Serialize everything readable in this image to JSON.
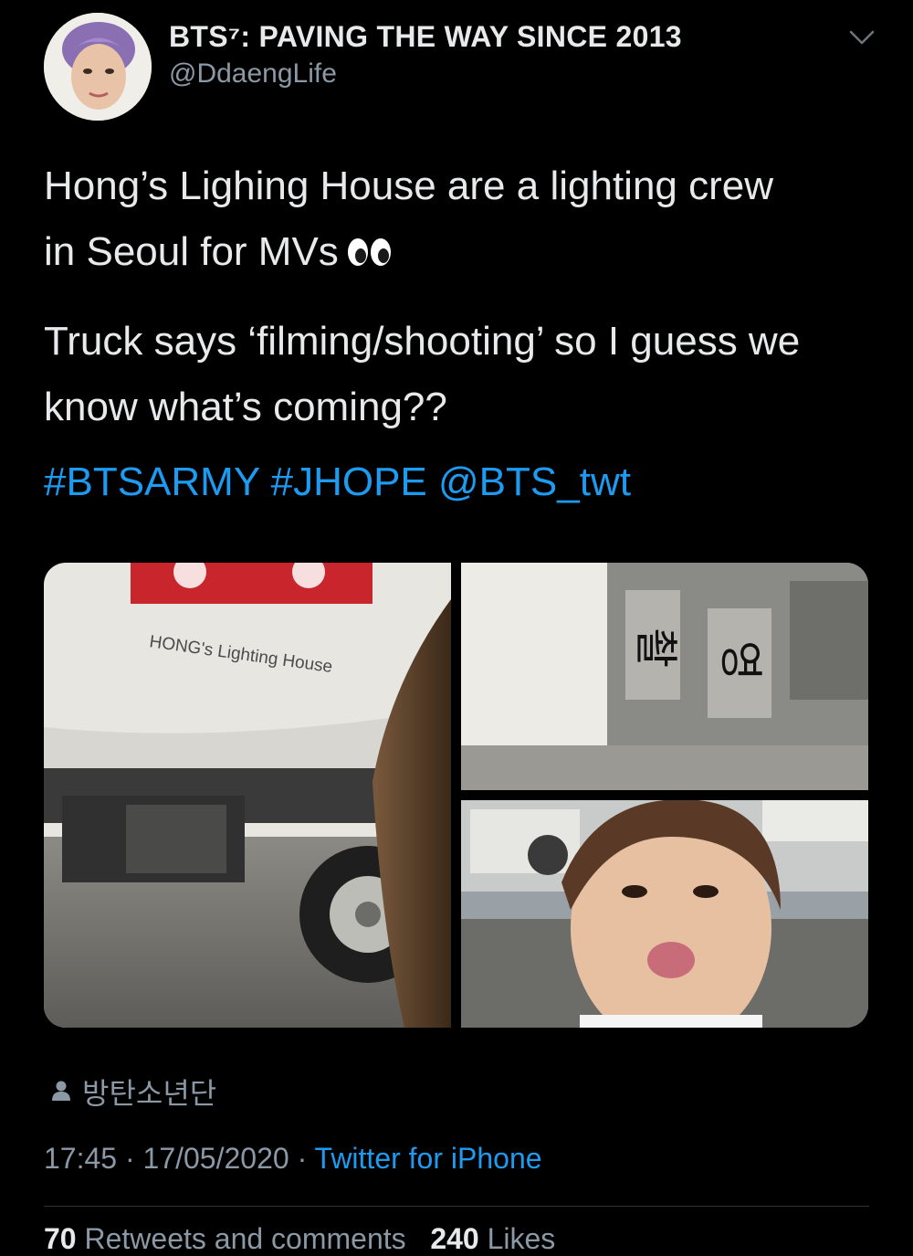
{
  "tweet": {
    "display_name": "BTS⁷: PAVING THE WAY SINCE 2013",
    "handle": "@DdaengLife",
    "line1": "Hong’s Lighing House are a lighting crew",
    "line2": "in Seoul for MVs",
    "emoji": "eyes",
    "para2": "Truck says ‘filming/shooting’ so I guess we know what’s coming??",
    "hashtag1": "#BTSARMY",
    "hashtag2": "#JHOPE",
    "mention": "@BTS_twt",
    "location": "방탄소년단",
    "time": "17:45",
    "date": "17/05/2020",
    "source": "Twitter for iPhone",
    "retweets_count": "70",
    "retweets_label": "Retweets and comments",
    "likes_count": "240",
    "likes_label": "Likes"
  },
  "media": {
    "truck_sign_text": "HONG's Lighting House",
    "truck_korean_1": "촬",
    "truck_korean_2": "영"
  },
  "colors": {
    "background": "#000000",
    "text": "#e7e9ea",
    "secondary": "#8b98a5",
    "link": "#1d9bf0"
  },
  "icons": [
    "chevron-down-icon",
    "person-icon",
    "eyes-emoji"
  ]
}
